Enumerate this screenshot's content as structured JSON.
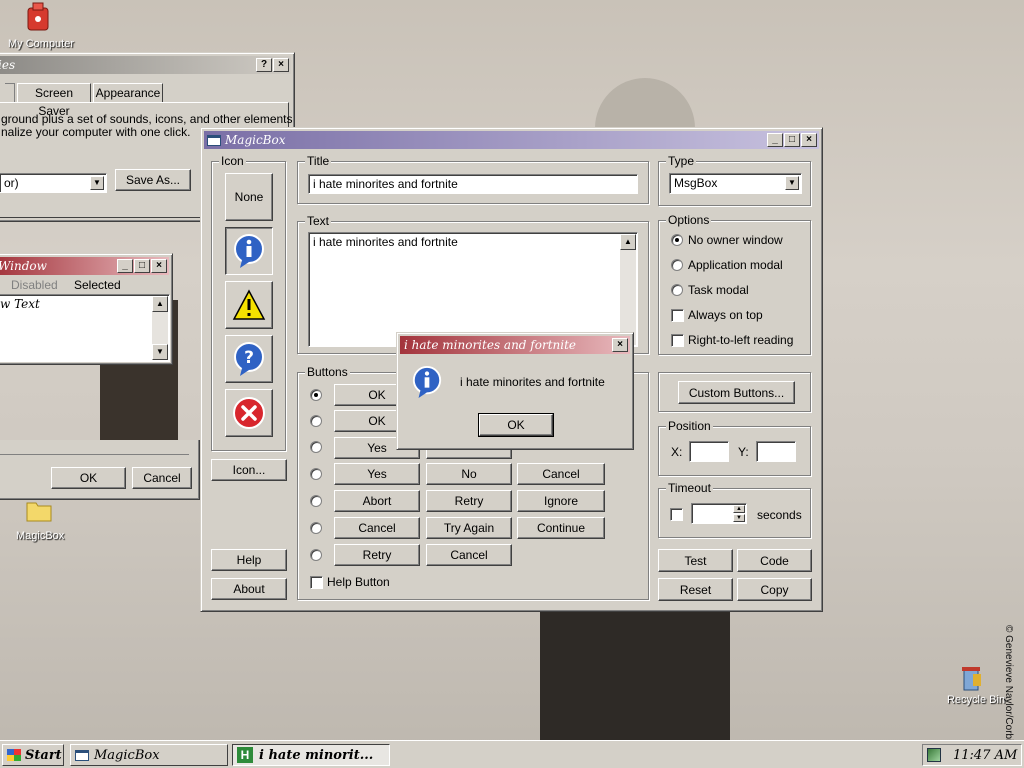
{
  "desktop": {
    "icons": [
      {
        "label": "My Computer"
      },
      {
        "label": "MagicBox"
      },
      {
        "label": "Recycle Bin"
      }
    ],
    "credit": "© Genevieve Naylor/Corbi"
  },
  "display_props": {
    "title": "ies",
    "tabs": [
      "Screen Saver",
      "Appearance"
    ],
    "desc_line1": "ground plus a set of sounds, icons, and other elements",
    "desc_line2": "nalize your computer with one click.",
    "combo_value": "or)",
    "save_as_label": "Save As...",
    "ok_label": "OK",
    "cancel_label": "Cancel"
  },
  "small_window": {
    "title": "Window",
    "tab_disabled": "Disabled",
    "tab_selected": "Selected",
    "content": "w Text"
  },
  "magicbox": {
    "title": "MagicBox",
    "icon_group_label": "Icon",
    "none_label": "None",
    "icon_button_label": "Icon...",
    "help_label": "Help",
    "about_label": "About",
    "title_group_label": "Title",
    "title_value": "i hate minorites and fortnite",
    "text_group_label": "Text",
    "text_value": "i hate minorites and fortnite",
    "type_group_label": "Type",
    "type_value": "MsgBox",
    "options_group_label": "Options",
    "options": [
      "No owner window",
      "Application modal",
      "Task modal",
      "Always on top",
      "Right-to-left reading"
    ],
    "buttons_group_label": "Buttons",
    "button_rows": [
      [
        "OK"
      ],
      [
        "OK"
      ],
      [
        "Yes"
      ],
      [
        "Yes",
        "No",
        "Cancel"
      ],
      [
        "Abort",
        "Retry",
        "Ignore"
      ],
      [
        "Cancel",
        "Try Again",
        "Continue"
      ],
      [
        "Retry",
        "Cancel"
      ]
    ],
    "help_button_label": "Help Button",
    "custom_buttons_label": "Custom Buttons...",
    "position_group_label": "Position",
    "x_label": "X:",
    "y_label": "Y:",
    "timeout_group_label": "Timeout",
    "seconds_label": "seconds",
    "test_label": "Test",
    "code_label": "Code",
    "reset_label": "Reset",
    "copy_label": "Copy"
  },
  "msgbox": {
    "title": "i hate minorites and fortnite",
    "message": "i hate minorites and fortnite",
    "ok_label": "OK"
  },
  "taskbar": {
    "start_label": "Start",
    "tasks": [
      "MagicBox",
      "i hate minorit..."
    ],
    "clock": "11:47 AM"
  },
  "colors": {
    "active_title": "#7a6fa6",
    "dialog_title": "#a3343c",
    "face": "#d4d0c8"
  }
}
